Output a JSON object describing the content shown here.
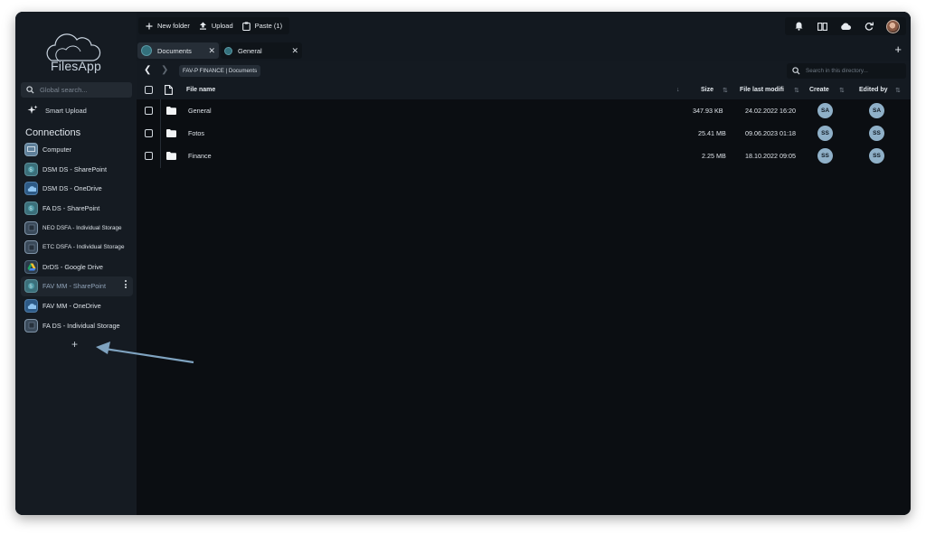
{
  "app": {
    "name": "FilesApp"
  },
  "sidebar": {
    "search_placeholder": "Global search...",
    "smart_upload_label": "Smart Upload",
    "connections_title": "Connections",
    "add_label": "+",
    "items": [
      {
        "label": "Computer",
        "icon": "computer-icon"
      },
      {
        "label": "DSM DS - SharePoint",
        "icon": "sharepoint-icon"
      },
      {
        "label": "DSM DS - OneDrive",
        "icon": "onedrive-icon"
      },
      {
        "label": "FA DS - SharePoint",
        "icon": "sharepoint-icon"
      },
      {
        "label": "NEO DSFA - Individual Storage",
        "icon": "storage-icon"
      },
      {
        "label": "ETC DSFA - Individual Storage",
        "icon": "storage-icon"
      },
      {
        "label": "DrDS - Google Drive",
        "icon": "google-drive-icon"
      },
      {
        "label": "FAV MM - SharePoint",
        "icon": "sharepoint-icon",
        "active": true
      },
      {
        "label": "FAV MM - OneDrive",
        "icon": "onedrive-icon"
      },
      {
        "label": "FA DS - Individual Storage",
        "icon": "storage-icon"
      }
    ]
  },
  "toolbar": {
    "new_folder": "New folder",
    "upload": "Upload",
    "paste": "Paste (1)"
  },
  "tabs": [
    {
      "label": "Documents",
      "active": true
    },
    {
      "label": "General",
      "active": false
    }
  ],
  "path": {
    "breadcrumb": "FAV-P FINANCE | Documents",
    "search_placeholder": "Search in this directory..."
  },
  "table": {
    "columns": {
      "name": "File name",
      "size": "Size",
      "modified": "File last modifi",
      "created": "Create",
      "edited": "Edited by"
    },
    "rows": [
      {
        "name": "General",
        "size": "347.93 KB",
        "modified": "24.02.2022 16:20",
        "created": "SA",
        "edited": "SA"
      },
      {
        "name": "Fotos",
        "size": "25.41 MB",
        "modified": "09.06.2023 01:18",
        "created": "SS",
        "edited": "SS"
      },
      {
        "name": "Finance",
        "size": "2.25 MB",
        "modified": "18.10.2022 09:05",
        "created": "SS",
        "edited": "SS"
      }
    ]
  },
  "colors": {
    "accent_badge": "#8fb0c8",
    "background": "#0b0e12",
    "annotation_arrow": "#7fa3c0"
  }
}
